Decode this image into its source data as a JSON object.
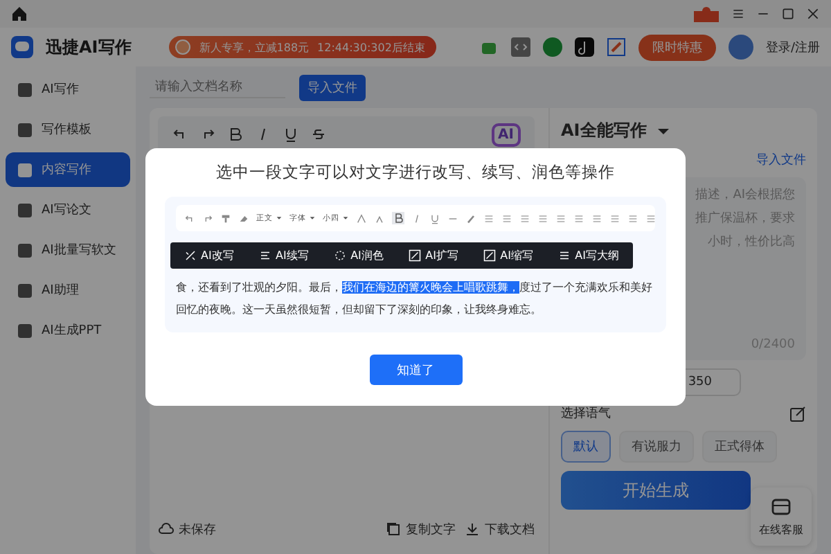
{
  "header": {
    "app_name": "迅捷AI写作",
    "promo": {
      "text": "新人专享，立减188元",
      "countdown": "12:44:30:302后结束"
    },
    "deal_button": "限时特惠",
    "login": "登录/注册"
  },
  "sidebar": {
    "items": [
      {
        "label": "AI写作",
        "selected": false
      },
      {
        "label": "写作模板",
        "selected": false
      },
      {
        "label": "内容写作",
        "selected": true
      },
      {
        "label": "AI写论文",
        "selected": false
      },
      {
        "label": "AI批量写软文",
        "selected": false
      },
      {
        "label": "AI助理",
        "selected": false
      },
      {
        "label": "AI生成PPT",
        "selected": false
      }
    ]
  },
  "editor_toolbar": {
    "ai_button": "AI"
  },
  "document": {
    "name_placeholder": "请输入文档名称",
    "import_button": "导入文件",
    "status": "未保存",
    "actions": [
      "复制文字",
      "下载文档"
    ]
  },
  "right_panel": {
    "title": "AI全能写作",
    "import_link": "导入文件",
    "prompt_hint": [
      "描述，AI会根据您",
      "推广保温杯，要求",
      "小时，性价比高"
    ],
    "counter": "0/2400",
    "length_value": "350",
    "tone_label": "选择语气",
    "tones": [
      {
        "label": "默认",
        "selected": true
      },
      {
        "label": "有说服力",
        "selected": false
      },
      {
        "label": "正式得体",
        "selected": false
      }
    ],
    "generate_button": "开始生成"
  },
  "support": {
    "label": "在线客服"
  },
  "dialog": {
    "title": "选中一段文字可以对文字进行改写、续写、润色等操作",
    "toolbar_dropdowns": [
      "正文",
      "字体",
      "小四"
    ],
    "paragraph": {
      "before": "食，还看到了壮观的夕阳。最后，",
      "selection": "我们在海边的篝火晚会上唱歌跳舞，",
      "after": "度过了一个充满欢乐和美好回忆的夜晚。这一天虽然很短暂，但却留下了深刻的印象，让我终身难忘。"
    },
    "ai_actions": [
      "AI改写",
      "AI续写",
      "AI润色",
      "AI扩写",
      "AI缩写",
      "AI写大纲"
    ],
    "confirm_button": "知道了"
  }
}
